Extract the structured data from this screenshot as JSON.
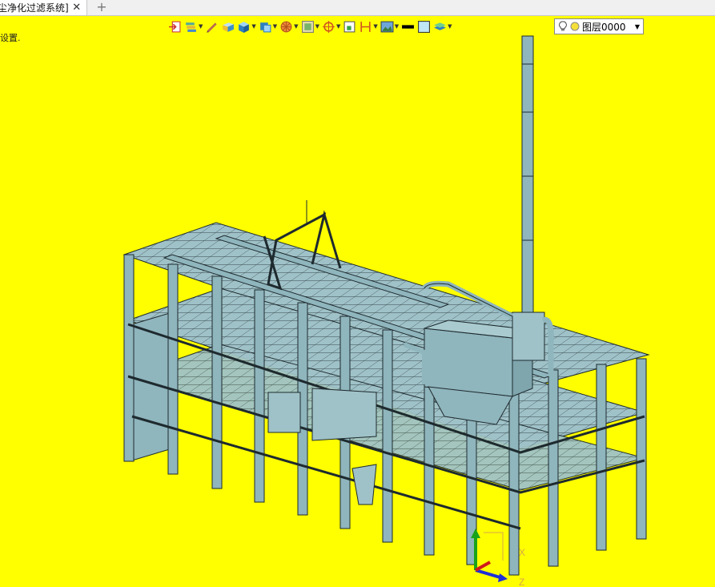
{
  "tab": {
    "title": "尘净化过滤系统]",
    "close_glyph": "✕",
    "new_tab_glyph": "+"
  },
  "status_text": "设置.",
  "toolbar": {
    "tools": [
      {
        "icon": "exit-sketch-icon",
        "dropdown": false
      },
      {
        "icon": "layer-stack-icon",
        "dropdown": true
      },
      {
        "icon": "pencil-icon",
        "dropdown": false
      },
      {
        "icon": "solid-box-icon",
        "dropdown": false
      },
      {
        "icon": "shaded-cube-icon",
        "dropdown": true
      },
      {
        "icon": "view-cube-icon",
        "dropdown": true
      },
      {
        "icon": "render-mode-icon",
        "dropdown": true
      },
      {
        "icon": "frame-icon",
        "dropdown": true
      },
      {
        "icon": "snap-target-icon",
        "dropdown": true
      },
      {
        "icon": "fit-view-icon",
        "dropdown": false
      },
      {
        "icon": "dimension-icon",
        "dropdown": true
      },
      {
        "icon": "image-icon",
        "dropdown": true
      },
      {
        "icon": "line-color-icon",
        "dropdown": false
      },
      {
        "icon": "fill-color-icon",
        "dropdown": false
      },
      {
        "icon": "layer-manager-icon",
        "dropdown": true
      }
    ],
    "layer": {
      "value": "图层0000"
    }
  },
  "viewport": {
    "background": "#ffff00",
    "model_color": "#8fb5bd",
    "line_color": "#1e2a2e"
  },
  "triad": {
    "x_label": "X",
    "z_label": "Z"
  }
}
